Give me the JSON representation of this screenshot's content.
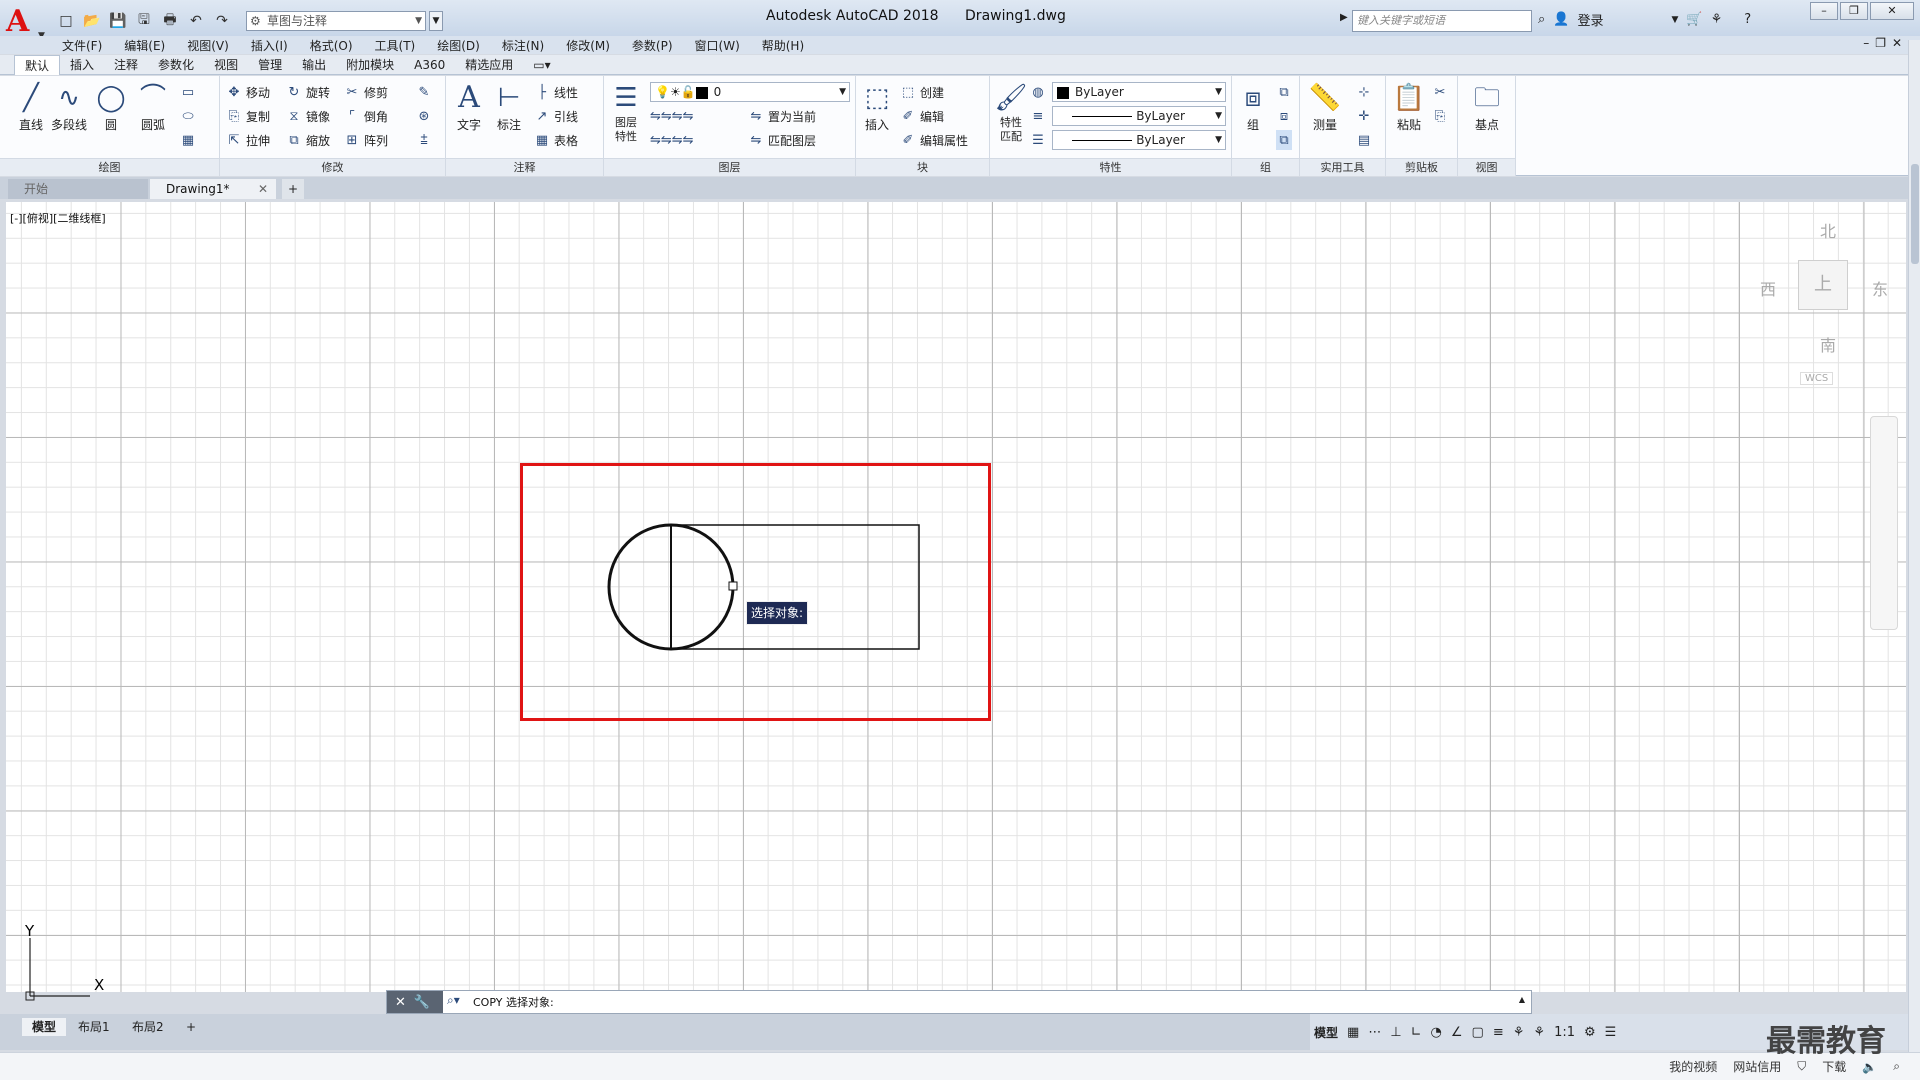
{
  "app": {
    "title": "Autodesk AutoCAD 2018",
    "file": "Drawing1.dwg",
    "logo": "A",
    "workspace": "草图与注释",
    "search_placeholder": "键入关键字或短语",
    "login": "登录"
  },
  "menu": [
    "文件(F)",
    "编辑(E)",
    "视图(V)",
    "插入(I)",
    "格式(O)",
    "工具(T)",
    "绘图(D)",
    "标注(N)",
    "修改(M)",
    "参数(P)",
    "窗口(W)",
    "帮助(H)"
  ],
  "ribbon_tabs": [
    "默认",
    "插入",
    "注释",
    "参数化",
    "视图",
    "管理",
    "输出",
    "附加模块",
    "A360",
    "精选应用"
  ],
  "ribbon": {
    "draw": {
      "title": "绘图",
      "line": "直线",
      "polyline": "多段线",
      "circle": "圆",
      "arc": "圆弧"
    },
    "modify": {
      "title": "修改",
      "move": "移动",
      "rotate": "旋转",
      "trim": "修剪",
      "copy": "复制",
      "mirror": "镜像",
      "fillet": "倒角",
      "stretch": "拉伸",
      "scale": "缩放",
      "array": "阵列"
    },
    "annotation": {
      "title": "注释",
      "text": "文字",
      "dimension": "标注",
      "linear": "线性",
      "leader": "引线",
      "table": "表格"
    },
    "layers": {
      "title": "图层",
      "layer_props": "图层特性",
      "layer_value": "0",
      "set_current": "置为当前",
      "match_layer": "匹配图层"
    },
    "block": {
      "title": "块",
      "insert": "插入",
      "create": "创建",
      "edit": "编辑",
      "edit_attr": "编辑属性"
    },
    "properties": {
      "title": "特性",
      "match": "特性匹配",
      "color": "ByLayer",
      "lineweight": "ByLayer",
      "linetype": "ByLayer"
    },
    "groups": {
      "title": "组",
      "group": "组"
    },
    "utilities": {
      "title": "实用工具",
      "measure": "测量"
    },
    "clipboard": {
      "title": "剪贴板",
      "paste": "粘贴"
    },
    "view": {
      "title": "视图",
      "base": "基点"
    }
  },
  "doc_tabs": {
    "start": "开始",
    "drawing": "Drawing1*"
  },
  "viewport": {
    "label": "[-][俯视][二维线框]",
    "tooltip": "选择对象:",
    "viewcube": {
      "north": "北",
      "south": "南",
      "east": "东",
      "west": "西",
      "top": "上",
      "wcs": "WCS"
    },
    "ucs_y": "Y",
    "ucs_x": "X"
  },
  "command_line": {
    "text": "COPY 选择对象:"
  },
  "layout_tabs": [
    "模型",
    "布局1",
    "布局2"
  ],
  "status": {
    "model": "模型",
    "scale": "1:1"
  },
  "taskbar": {
    "my_video": "我的视频",
    "net_credit": "网站信用",
    "download": "下载"
  },
  "watermark": "最需教育"
}
